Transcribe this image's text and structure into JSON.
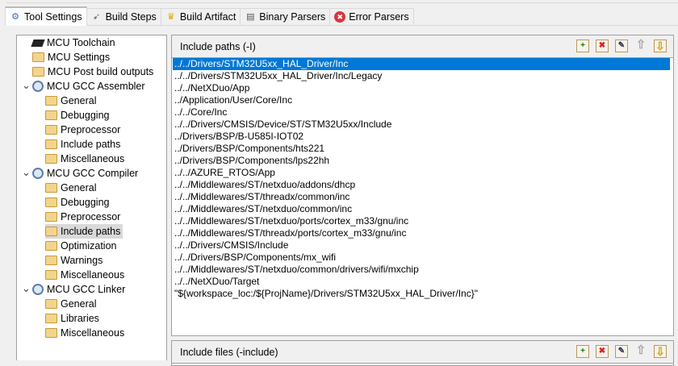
{
  "tabs": [
    {
      "label": "Tool Settings",
      "icon": "tool-settings-icon",
      "active": true
    },
    {
      "label": "Build Steps",
      "icon": "build-steps-icon"
    },
    {
      "label": "Build Artifact",
      "icon": "trophy-icon"
    },
    {
      "label": "Binary Parsers",
      "icon": "binary-icon"
    },
    {
      "label": "Error Parsers",
      "icon": "error-icon"
    }
  ],
  "tree": [
    {
      "label": "MCU Toolchain",
      "icon": "chip",
      "level": 0
    },
    {
      "label": "MCU Settings",
      "icon": "folder",
      "level": 0
    },
    {
      "label": "MCU Post build outputs",
      "icon": "folder",
      "level": 0
    },
    {
      "label": "MCU GCC Assembler",
      "icon": "gear",
      "level": 0,
      "expanded": true
    },
    {
      "label": "General",
      "icon": "folder",
      "level": 1
    },
    {
      "label": "Debugging",
      "icon": "folder",
      "level": 1
    },
    {
      "label": "Preprocessor",
      "icon": "folder",
      "level": 1
    },
    {
      "label": "Include paths",
      "icon": "folder",
      "level": 1
    },
    {
      "label": "Miscellaneous",
      "icon": "folder",
      "level": 1
    },
    {
      "label": "MCU GCC Compiler",
      "icon": "gear",
      "level": 0,
      "expanded": true
    },
    {
      "label": "General",
      "icon": "folder",
      "level": 1
    },
    {
      "label": "Debugging",
      "icon": "folder",
      "level": 1
    },
    {
      "label": "Preprocessor",
      "icon": "folder",
      "level": 1
    },
    {
      "label": "Include paths",
      "icon": "folder",
      "level": 1,
      "selected": true
    },
    {
      "label": "Optimization",
      "icon": "folder",
      "level": 1
    },
    {
      "label": "Warnings",
      "icon": "folder",
      "level": 1
    },
    {
      "label": "Miscellaneous",
      "icon": "folder",
      "level": 1
    },
    {
      "label": "MCU GCC Linker",
      "icon": "gear",
      "level": 0,
      "expanded": true
    },
    {
      "label": "General",
      "icon": "folder",
      "level": 1
    },
    {
      "label": "Libraries",
      "icon": "folder",
      "level": 1
    },
    {
      "label": "Miscellaneous",
      "icon": "folder",
      "level": 1
    }
  ],
  "include_paths": {
    "title": "Include paths (-I)",
    "items": [
      "../../Drivers/STM32U5xx_HAL_Driver/Inc",
      "../../Drivers/STM32U5xx_HAL_Driver/Inc/Legacy",
      "../../NetXDuo/App",
      "../Application/User/Core/Inc",
      "../../Core/Inc",
      "../../Drivers/CMSIS/Device/ST/STM32U5xx/Include",
      "../Drivers/BSP/B-U585I-IOT02",
      "../Drivers/BSP/Components/hts221",
      "../Drivers/BSP/Components/lps22hh",
      "../../AZURE_RTOS/App",
      "../../Middlewares/ST/netxduo/addons/dhcp",
      "../../Middlewares/ST/threadx/common/inc",
      "../../Middlewares/ST/netxduo/common/inc",
      "../../Middlewares/ST/netxduo/ports/cortex_m33/gnu/inc",
      "../../Middlewares/ST/threadx/ports/cortex_m33/gnu/inc",
      "../../Drivers/CMSIS/Include",
      "../../Drivers/BSP/Components/mx_wifi",
      "../../Middlewares/ST/netxduo/common/drivers/wifi/mxchip",
      "../../NetXDuo/Target",
      "\"${workspace_loc:/${ProjName}/Drivers/STM32U5xx_HAL_Driver/Inc}\""
    ],
    "selected_index": 0
  },
  "include_files": {
    "title": "Include files (-include)"
  },
  "toolbar": [
    {
      "name": "add",
      "glyph": "+",
      "color": "#1a7a1a"
    },
    {
      "name": "delete",
      "glyph": "✖",
      "color": "#d22"
    },
    {
      "name": "edit",
      "glyph": "✎",
      "color": "#335"
    },
    {
      "name": "move-up",
      "glyph": "⇧",
      "color": "#aaa"
    },
    {
      "name": "move-down",
      "glyph": "⇩",
      "color": "#d9a400"
    }
  ]
}
